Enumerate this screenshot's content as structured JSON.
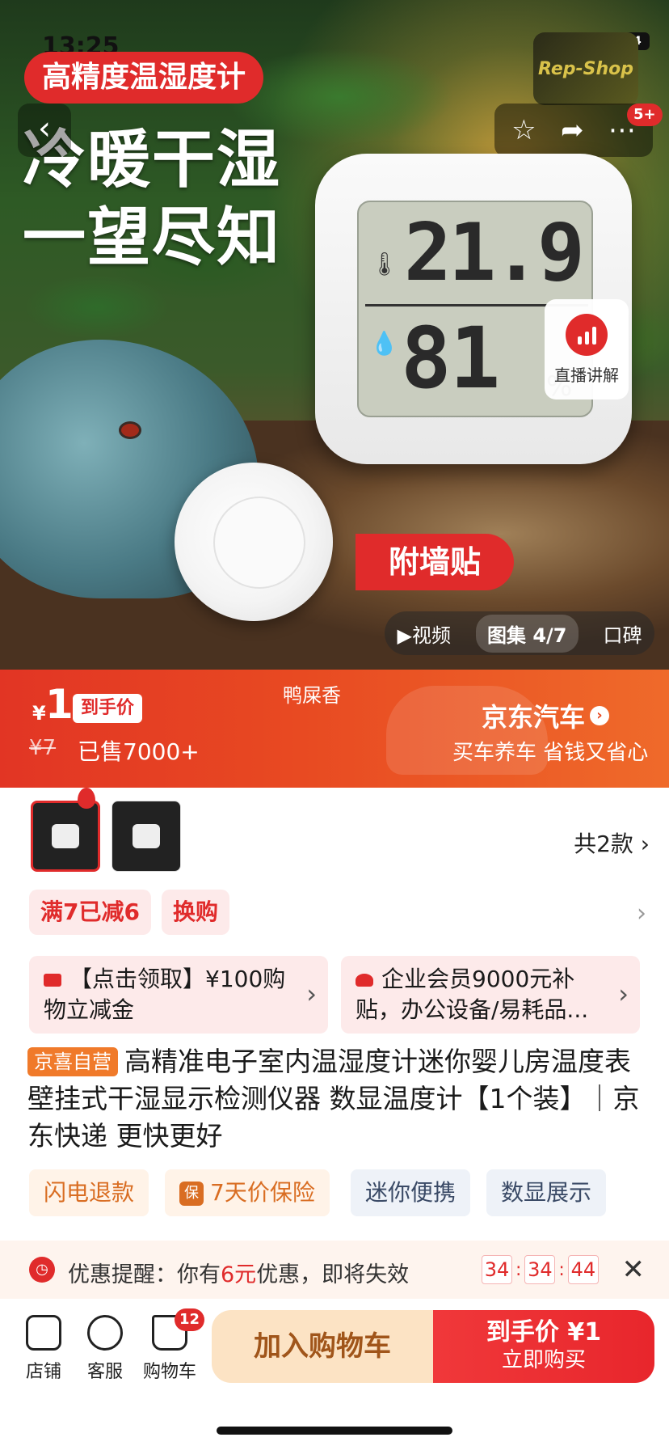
{
  "status": {
    "time": "13:25",
    "battery": "34"
  },
  "hero": {
    "badge": "高精度温湿度计",
    "heading_line1": "冷暖干湿",
    "heading_line2": "一望尽知",
    "logo_text": "Rep-Shop",
    "notification_count": "5+",
    "live_label": "直播讲解",
    "wall_badge": "附墙贴",
    "display_temp": "21.9",
    "display_hum": "81",
    "display_pct": "%",
    "media": {
      "video": "▶视频",
      "gallery": "图集 4/7",
      "reviews": "口碑"
    }
  },
  "price": {
    "yen": "¥",
    "value": "1",
    "tag": "到手价",
    "original": "¥7",
    "sold": "已售7000+",
    "center_note": "鸭屎香",
    "ad_title": "京东汽车",
    "ad_sub": "买车养车 省钱又省心"
  },
  "variants": {
    "count_label": "共2款"
  },
  "promos": [
    "满7已减6",
    "换购"
  ],
  "coupons": [
    {
      "text": "【点击领取】¥100购物立减金"
    },
    {
      "text": "企业会员9000元补贴，办公设备/易耗品..."
    }
  ],
  "product": {
    "self_tag": "京喜自营",
    "title": "高精准电子室内温湿度计迷你婴儿房温度表壁挂式干湿显示检测仪器 数显温度计【1个装】｜京东快递 更快更好"
  },
  "features": [
    {
      "label": "闪电退款"
    },
    {
      "label": "7天价保险",
      "icon": "保"
    },
    {
      "label": "迷你便携"
    },
    {
      "label": "数显展示"
    }
  ],
  "reminder": {
    "prefix": "优惠提醒：你有",
    "amount": "6元",
    "suffix": "优惠，即将失效",
    "h": "34",
    "m": "34",
    "s": "44"
  },
  "bottom": {
    "shop": "店铺",
    "service": "客服",
    "cart": "购物车",
    "cart_count": "12",
    "add_cart": "加入购物车",
    "buy_line1": "到手价 ¥1",
    "buy_line2": "立即购买"
  }
}
